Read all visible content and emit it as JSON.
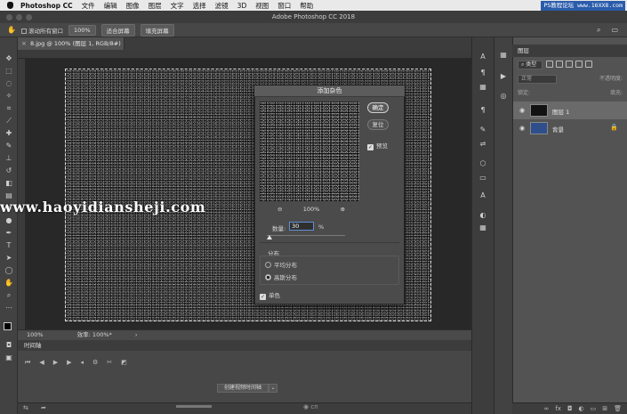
{
  "menubar": {
    "app_name": "Photoshop CC",
    "items": [
      "文件",
      "编辑",
      "图像",
      "图层",
      "文字",
      "选择",
      "滤镜",
      "3D",
      "视图",
      "窗口",
      "帮助"
    ]
  },
  "watermark_top": "PS教程论坛 www.16XX8.com",
  "window_title": "Adobe Photoshop CC 2018",
  "options_bar": {
    "scroll_all": "滚动所有窗口",
    "zoom": "100%",
    "fit_screen": "适合屏幕",
    "fill_screen": "填充屏幕"
  },
  "document": {
    "tab_title": "8.jpg @ 100% (图层 1, RGB/8#)",
    "tab_close": "×",
    "status_zoom": "100%",
    "status_doc": "效率: 100%*"
  },
  "timeline": {
    "panel_title": "时间轴",
    "create_button": "创建视频时间轴"
  },
  "bottom_logo": "cn",
  "watermark_site": "www.haoyidiansheji.com",
  "layers_panel": {
    "tab": "图层",
    "kind": "类型",
    "mode": "正常",
    "opacity": "不透明度:",
    "lock": "锁定:",
    "fill": "填充:",
    "layers": [
      {
        "name": "图层 1",
        "selected": true,
        "thumb_color": "#121212"
      },
      {
        "name": "背景",
        "selected": false,
        "thumb_color": "#2e4f8c"
      }
    ]
  },
  "dialog": {
    "title": "添加杂色",
    "ok": "确定",
    "reset": "复位",
    "preview": "预览",
    "zoom_value": "100%",
    "zoom_out": "−",
    "zoom_in": "+",
    "amount_label": "数量:",
    "amount_value": "30",
    "amount_unit": "%",
    "distribution_label": "分布",
    "uniform": "平均分布",
    "gaussian": "高斯分布",
    "monochromatic": "单色"
  },
  "colors": {
    "accent": "#5f8fd8",
    "watermark_bg": "#2a5cab"
  }
}
